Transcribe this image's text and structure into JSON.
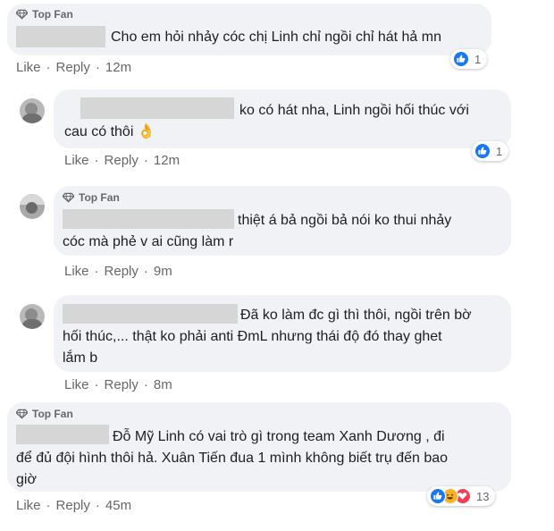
{
  "badge_label": "Top Fan",
  "colors": {
    "bubble": "#f0f2f5",
    "like_blue": "#1877f2",
    "love_red": "#f33e58",
    "haha_yellow": "#f7b125",
    "muted": "#65676b"
  },
  "comments": [
    {
      "text_lines": [
        "Cho em hỏi nhảy cóc chị Linh chỉ ngồi chỉ hát hả mn"
      ],
      "actions": {
        "like": "Like",
        "reply": "Reply",
        "time": "12m"
      },
      "reaction_count": "1",
      "reaction_icons": [
        "like-icon"
      ]
    },
    {
      "text_lines": [
        "ko có hát nha, Linh ngồi hối thúc với",
        "cau có thôi"
      ],
      "emoji": "👌",
      "actions": {
        "like": "Like",
        "reply": "Reply",
        "time": "12m"
      },
      "reaction_count": "1",
      "reaction_icons": [
        "like-icon"
      ]
    },
    {
      "text_lines": [
        "thiệt á bả ngồi bả nói ko thui nhảy",
        "cóc mà phẻ v ai cũng làm r"
      ],
      "actions": {
        "like": "Like",
        "reply": "Reply",
        "time": "9m"
      }
    },
    {
      "text_lines": [
        "Đã ko làm đc gì thì thôi, ngồi trên bờ",
        "hối thúc,... thật ko phải anti ĐmL nhưng thái độ đó thay ghet",
        "lắm b"
      ],
      "actions": {
        "like": "Like",
        "reply": "Reply",
        "time": "8m"
      }
    },
    {
      "text_lines": [
        "Đỗ Mỹ Linh có vai trò gì trong team Xanh Dương , đi",
        "để đủ đội hình thôi hả. Xuân Tiến đua 1 mình không biết trụ đến bao",
        "giờ"
      ],
      "actions": {
        "like": "Like",
        "reply": "Reply",
        "time": "45m"
      },
      "reaction_count": "13",
      "reaction_icons": [
        "like-icon",
        "haha-icon",
        "love-icon"
      ]
    }
  ]
}
